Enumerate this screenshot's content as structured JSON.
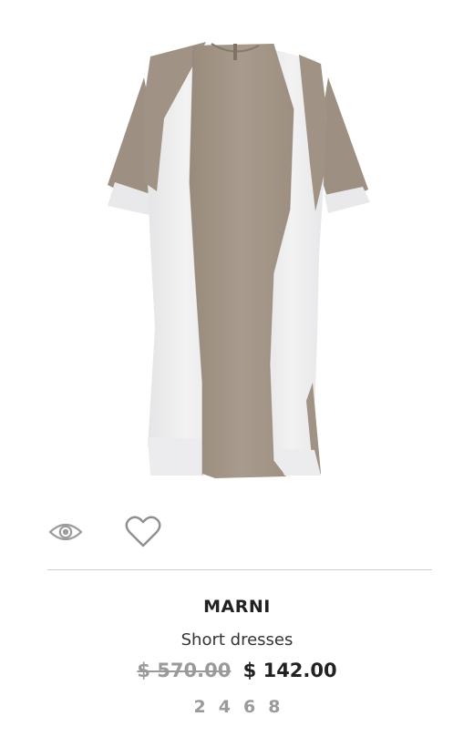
{
  "product": {
    "brand": "MARNI",
    "category": "Short dresses",
    "original_price": "$ 570.00",
    "sale_price": "$ 142.00",
    "sizes": [
      "2",
      "4",
      "6",
      "8"
    ],
    "image_icon": "dress-image",
    "colors": {
      "taupe": "#a5988a",
      "white_panel": "#eeeeef",
      "price_old": "#9a9a9a",
      "text_dark": "#222222"
    }
  },
  "actions": {
    "quickview_icon": "eye-icon",
    "wishlist_icon": "heart-icon"
  }
}
